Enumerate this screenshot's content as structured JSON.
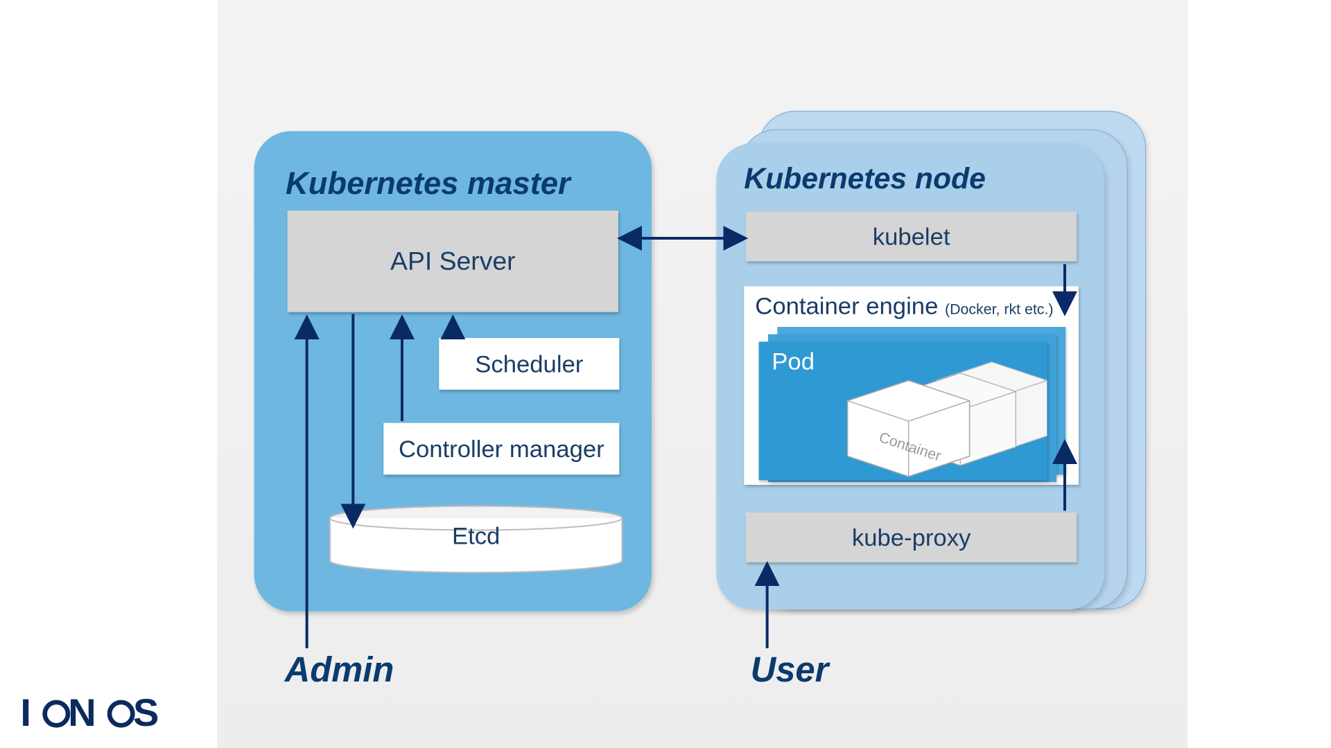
{
  "logo": "IONOS",
  "master": {
    "title": "Kubernetes master",
    "api_server": "API Server",
    "scheduler": "Scheduler",
    "controller": "Controller manager",
    "etcd": "Etcd"
  },
  "node": {
    "title": "Kubernetes node",
    "kubelet": "kubelet",
    "engine": "Container engine",
    "engine_note": "(Docker, rkt etc.)",
    "pod": "Pod",
    "container_label": "Container",
    "kube_proxy": "kube-proxy"
  },
  "roles": {
    "admin": "Admin",
    "user": "User"
  },
  "arrows": [
    {
      "from": "admin",
      "to": "api-server",
      "type": "single"
    },
    {
      "from": "api-server",
      "to": "etcd",
      "type": "single"
    },
    {
      "from": "controller",
      "to": "api-server",
      "type": "single"
    },
    {
      "from": "scheduler",
      "to": "api-server",
      "type": "single"
    },
    {
      "from": "api-server",
      "to": "kubelet",
      "type": "double"
    },
    {
      "from": "kubelet",
      "to": "engine",
      "type": "single"
    },
    {
      "from": "kube-proxy",
      "to": "engine",
      "type": "single"
    },
    {
      "from": "user",
      "to": "kube-proxy",
      "type": "single"
    }
  ]
}
